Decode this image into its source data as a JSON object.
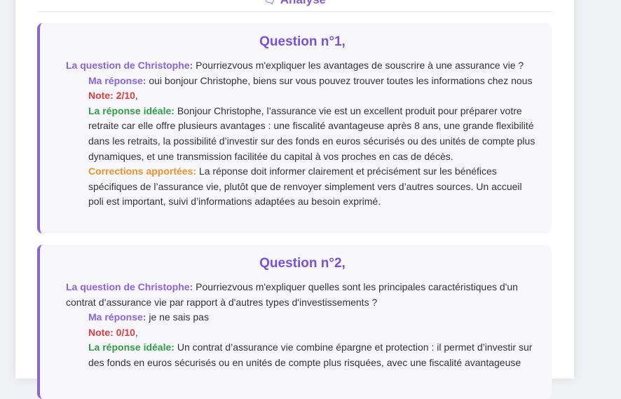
{
  "header": {
    "title": "Analyse",
    "icon": "chat-bubble-icon"
  },
  "questions": [
    {
      "title": "Question n°1,",
      "question_label": "La question de Christophe:",
      "question_text": " Pourriezvous m'expliquer les avantages de souscrire à une assurance vie ?",
      "answer_label": "Ma réponse:",
      "answer_text": " oui bonjour Christophe, biens sur vous pouvez trouver toutes les informations chez nous",
      "note_label": "Note: 2/10",
      "note_suffix": ",",
      "ideal_label": "La réponse idéale:",
      "ideal_text": " Bonjour Christophe, l’assurance vie est un excellent produit pour préparer votre retraite car elle offre plusieurs avantages : une fiscalité avantageuse après 8 ans, une grande flexibilité dans les retraits, la possibilité d’investir sur des fonds en euros sécurisés ou des unités de compte plus dynamiques, et une transmission facilitée du capital à vos proches en cas de décès.",
      "corrections_label": "Corrections apportées:",
      "corrections_text": " La réponse doit informer clairement et précisément sur les bénéfices spécifiques de l’assurance vie, plutôt que de renvoyer simplement vers d’autres sources. Un accueil poli est important, suivi d’informations adaptées au besoin exprimé."
    },
    {
      "title": "Question n°2,",
      "question_label": "La question de Christophe:",
      "question_text": " Pourriezvous m'expliquer quelles sont les principales caractéristiques d'un contrat d’assurance vie par rapport à d'autres types d'investissements ?",
      "answer_label": "Ma réponse:",
      "answer_text": " je ne sais pas",
      "note_label": "Note: 0/10",
      "note_suffix": ",",
      "ideal_label": "La réponse idéale:",
      "ideal_text": " Un contrat d’assurance vie combine épargne et protection : il permet d’investir sur des fonds en euros sécurisés ou en unités de compte plus risquées, avec une fiscalité avantageuse"
    }
  ],
  "colors": {
    "accent_purple": "#8a63e3",
    "title_purple": "#7b4fde",
    "note_red": "#e03c3c",
    "ideal_green": "#2f9e44",
    "corrections_orange": "#f0902a",
    "card_bg": "#f7f7fc"
  }
}
